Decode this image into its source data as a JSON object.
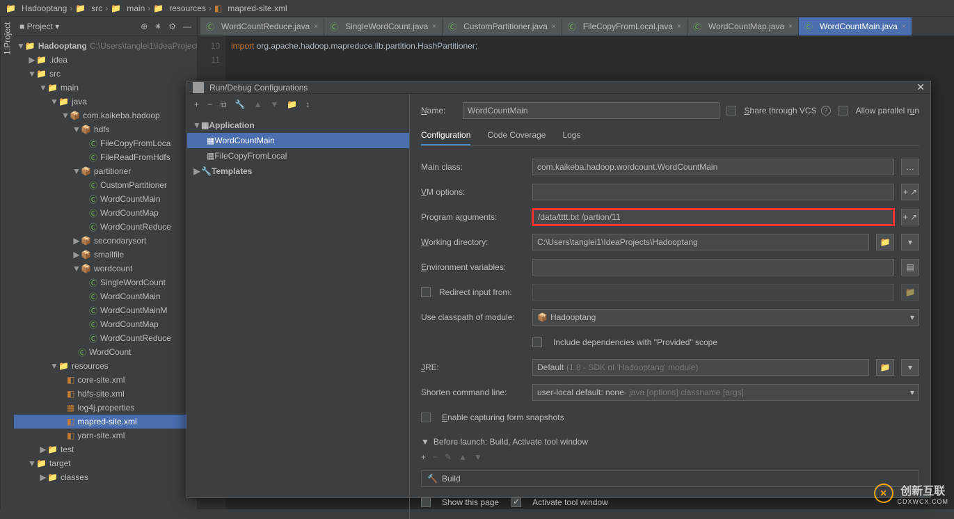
{
  "breadcrumb": [
    "Hadooptang",
    "src",
    "main",
    "resources",
    "mapred-site.xml"
  ],
  "projectPanel": {
    "title": "Project",
    "root": {
      "label": "Hadooptang",
      "path": "C:\\Users\\tanglei1\\IdeaProjects"
    }
  },
  "tree": {
    "idea": ".idea",
    "src": "src",
    "main": "main",
    "java": "java",
    "pkg": "com.kaikeba.hadoop",
    "hdfs": "hdfs",
    "hdfs_files": [
      "FileCopyFromLoca",
      "FileReadFromHdfs"
    ],
    "partitioner": "partitioner",
    "partitioner_files": [
      "CustomPartitioner",
      "WordCountMain",
      "WordCountMap",
      "WordCountReduce"
    ],
    "secondarysort": "secondarysort",
    "smallfile": "smallfile",
    "wordcount": "wordcount",
    "wordcount_files": [
      "SingleWordCount",
      "WordCountMain",
      "WordCountMainM",
      "WordCountMap",
      "WordCountReduce"
    ],
    "wordcount_obj": "WordCount",
    "resources": "resources",
    "resource_files": [
      "core-site.xml",
      "hdfs-site.xml",
      "log4j.properties",
      "mapred-site.xml",
      "yarn-site.xml"
    ],
    "test": "test",
    "target": "target",
    "classes": "classes"
  },
  "tabs": [
    {
      "label": "WordCountReduce.java"
    },
    {
      "label": "SingleWordCount.java"
    },
    {
      "label": "CustomPartitioner.java"
    },
    {
      "label": "FileCopyFromLocal.java"
    },
    {
      "label": "WordCountMap.java"
    },
    {
      "label": "WordCountMain.java",
      "active": true
    }
  ],
  "code": {
    "line10": {
      "kw": "import",
      "rest": " org.apache.hadoop.mapreduce.lib.partition.HashPartitioner;"
    },
    "gutterLines": [
      "10",
      "11"
    ]
  },
  "dialog": {
    "title": "Run/Debug Configurations",
    "tree": {
      "application": "Application",
      "items": [
        "WordCountMain",
        "FileCopyFromLocal"
      ],
      "templates": "Templates"
    },
    "nameLabel": "Name:",
    "nameValue": "WordCountMain",
    "shareLabel": "Share through VCS",
    "allowParallel": "Allow parallel run",
    "configTabs": [
      "Configuration",
      "Code Coverage",
      "Logs"
    ],
    "form": {
      "mainClassLabel": "Main class:",
      "mainClassValue": "com.kaikeba.hadoop.wordcount.WordCountMain",
      "vmLabel": "VM options:",
      "vmValue": "",
      "argsLabel": "Program arguments:",
      "argsValue": "/data/tttt.txt /partion/11",
      "wdLabel": "Working directory:",
      "wdValue": "C:\\Users\\tanglei1\\IdeaProjects\\Hadooptang",
      "envLabel": "Environment variables:",
      "envValue": "",
      "redirectLabel": "Redirect input from:",
      "classpathLabel": "Use classpath of module:",
      "classpathValue": "Hadooptang",
      "includeDeps": "Include dependencies with \"Provided\" scope",
      "jreLabel": "JRE:",
      "jreValue": "Default",
      "jreHint": "(1.8 - SDK of 'Hadooptang' module)",
      "shortenLabel": "Shorten command line:",
      "shortenValue": "user-local default: none",
      "shortenHint": " - java [options] classname [args]",
      "enableSnapshots": "Enable capturing form snapshots"
    },
    "beforeLaunch": "Before launch: Build, Activate tool window",
    "build": "Build",
    "showPage": "Show this page",
    "activateToolWindow": "Activate tool window"
  },
  "watermark": {
    "brand": "创新互联",
    "url": "CDXWCX.COM"
  },
  "sidebarLabel": "1:Project"
}
